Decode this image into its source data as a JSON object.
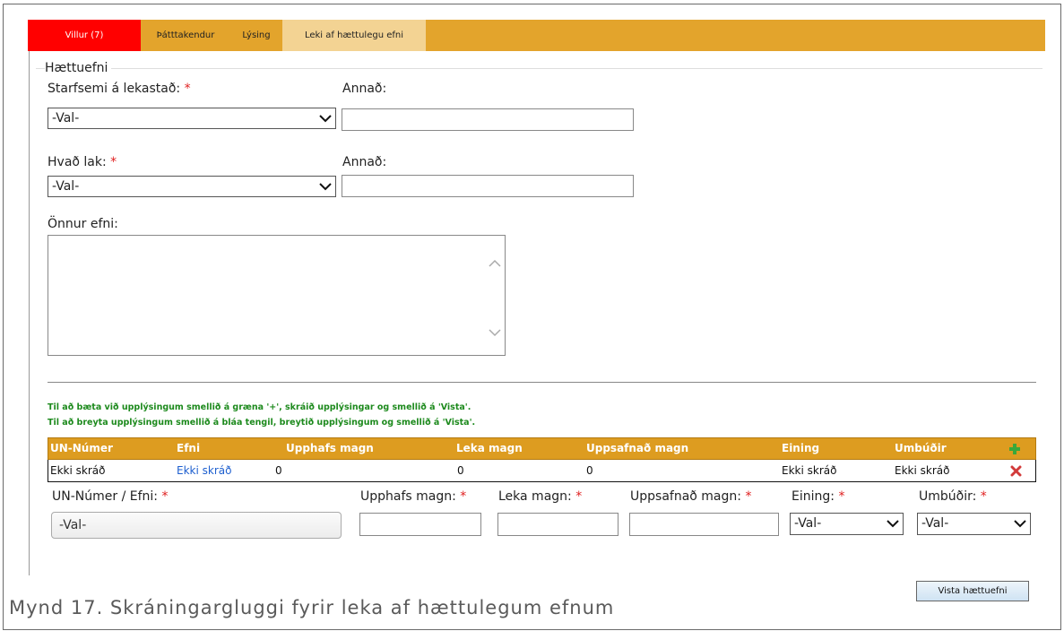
{
  "tabs": [
    {
      "label": "Villur (7)"
    },
    {
      "label": "Þátttakendur"
    },
    {
      "label": "Lýsing"
    },
    {
      "label": "Leki af hættulegu efni"
    }
  ],
  "form": {
    "legend": "Hættuefni",
    "required_mark": "*",
    "starfsemi_label": "Starfsemi á lekastað:",
    "starfsemi_value": "-Val-",
    "annad1_label": "Annað:",
    "annad1_value": "",
    "hvad_lak_label": "Hvað lak:",
    "hvad_lak_value": "-Val-",
    "annad2_label": "Annað:",
    "annad2_value": "",
    "onnur_efni_label": "Önnur efni:",
    "onnur_efni_value": ""
  },
  "hints": {
    "add": "Til að bæta við upplýsingum smellið á græna '+', skráið upplýsingar og smellið á 'Vista'.",
    "edit": "Til að breyta upplýsingum smellið á bláa tengil, breytið upplýsingum og smellið á 'Vista'."
  },
  "table": {
    "headers": [
      "UN-Númer",
      "Efni",
      "Upphafs magn",
      "Leka magn",
      "Uppsafnað magn",
      "Eining",
      "Umbúðir"
    ],
    "rows": [
      [
        "Ekki skráð",
        "Ekki skráð",
        "0",
        "0",
        "0",
        "Ekki skráð",
        "Ekki skráð"
      ]
    ]
  },
  "entry": {
    "un_label": "UN-Númer / Efni:",
    "un_value": "-Val-",
    "upphafs_label": "Upphafs magn:",
    "leka_label": "Leka magn:",
    "uppsafnad_label": "Uppsafnað magn:",
    "eining_label": "Eining:",
    "eining_value": "-Val-",
    "umbudir_label": "Umbúðir:",
    "umbudir_value": "-Val-",
    "save_button": "Vista hættuefni"
  },
  "caption": "Mynd 17. Skráningargluggi fyrir leka af hættulegum efnum",
  "colors": {
    "tabbar": "#e3a42c",
    "error_tab": "#ff0000",
    "active_tab": "#f3d393",
    "table_header": "#dd9c20",
    "hint_green": "#1d8a1d",
    "link_blue": "#1d5fcf"
  },
  "icons": [
    "chevron-down-icon",
    "scroll-up-icon",
    "scroll-down-icon",
    "add-plus-icon",
    "delete-x-icon"
  ]
}
